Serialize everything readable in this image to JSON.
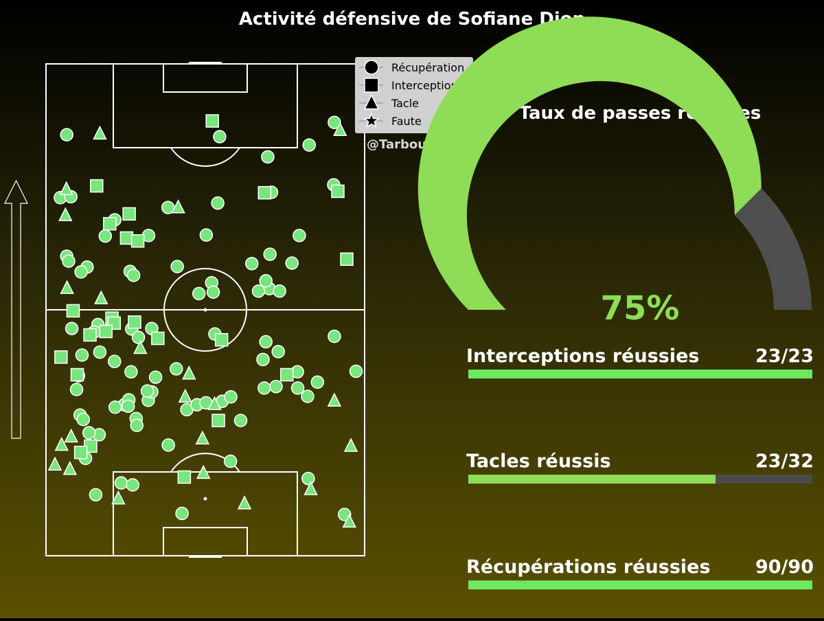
{
  "title": "Activité défensive de Sofiane Diop",
  "credit": "@TarbouchData",
  "colors": {
    "marker": "#77e67c",
    "gauge_fill": "#8fdc57",
    "gauge_rest": "#4f4f4f",
    "bar_fill": "#6ee85f",
    "bar_fill_partial": "#8fdc57",
    "bar_rest": "#4a4a4a",
    "legend_bg": "#d0d0d0"
  },
  "chart_data": [
    {
      "type": "scatter",
      "legend": {
        "placement": "top-right",
        "entries": [
          {
            "label": "Récupération",
            "shape": "circle"
          },
          {
            "label": "Interception",
            "shape": "square"
          },
          {
            "label": "Tacle",
            "shape": "triangle"
          },
          {
            "label": "Faute",
            "shape": "star"
          }
        ]
      },
      "xlim": [
        0,
        100
      ],
      "ylim": [
        0,
        100
      ],
      "series": [
        {
          "name": "Récupération",
          "shape": "circle",
          "points": [
            [
              6.5,
              85.6
            ],
            [
              54.5,
              85.2
            ],
            [
              90.5,
              88.1
            ],
            [
              82.6,
              83.5
            ],
            [
              69.6,
              81.1
            ],
            [
              4.5,
              72.8
            ],
            [
              7.8,
              73.0
            ],
            [
              70.8,
              73.9
            ],
            [
              90.3,
              75.4
            ],
            [
              53.9,
              71.7
            ],
            [
              38.3,
              70.8
            ],
            [
              21.6,
              68.3
            ],
            [
              18.6,
              65.0
            ],
            [
              32.2,
              65.1
            ],
            [
              79.5,
              65.1
            ],
            [
              50.3,
              65.2
            ],
            [
              6.5,
              60.9
            ],
            [
              7.1,
              59.9
            ],
            [
              12.9,
              58.7
            ],
            [
              11.0,
              57.7
            ],
            [
              26.4,
              57.8
            ],
            [
              27.5,
              57.0
            ],
            [
              41.2,
              58.8
            ],
            [
              64.6,
              59.4
            ],
            [
              70.3,
              61.3
            ],
            [
              77.2,
              59.5
            ],
            [
              52.0,
              55.5
            ],
            [
              52.5,
              53.6
            ],
            [
              48.0,
              53.3
            ],
            [
              70.1,
              54.3
            ],
            [
              69.0,
              55.9
            ],
            [
              66.7,
              53.8
            ],
            [
              73.3,
              53.8
            ],
            [
              16.3,
              47.0
            ],
            [
              8.1,
              46.2
            ],
            [
              15.1,
              45.5
            ],
            [
              26.9,
              46.1
            ],
            [
              33.2,
              46.2
            ],
            [
              29.0,
              44.4
            ],
            [
              53.0,
              45.1
            ],
            [
              90.5,
              44.6
            ],
            [
              69.0,
              43.5
            ],
            [
              72.9,
              41.5
            ],
            [
              11.3,
              40.8
            ],
            [
              16.9,
              41.4
            ],
            [
              21.5,
              39.5
            ],
            [
              26.7,
              37.4
            ],
            [
              34.4,
              36.3
            ],
            [
              40.9,
              38.0
            ],
            [
              68.1,
              39.9
            ],
            [
              97.3,
              37.5
            ],
            [
              78.9,
              37.4
            ],
            [
              10.2,
              36.6
            ],
            [
              9.6,
              33.8
            ],
            [
              68.5,
              34.1
            ],
            [
              72.2,
              34.4
            ],
            [
              79.0,
              34.1
            ],
            [
              85.2,
              35.3
            ],
            [
              82.1,
              32.4
            ],
            [
              24.6,
              30.7
            ],
            [
              21.7,
              30.2
            ],
            [
              26.0,
              31.7
            ],
            [
              25.8,
              30.4
            ],
            [
              32.1,
              31.6
            ],
            [
              33.2,
              33.3
            ],
            [
              31.8,
              33.5
            ],
            [
              44.2,
              29.7
            ],
            [
              47.4,
              30.7
            ],
            [
              50.2,
              31.1
            ],
            [
              55.3,
              31.4
            ],
            [
              58.0,
              32.3
            ],
            [
              61.1,
              27.5
            ],
            [
              10.7,
              28.6
            ],
            [
              11.7,
              27.7
            ],
            [
              28.3,
              27.9
            ],
            [
              28.5,
              26.5
            ],
            [
              16.7,
              24.6
            ],
            [
              13.5,
              25.0
            ],
            [
              38.4,
              22.5
            ],
            [
              11.8,
              20.5
            ],
            [
              12.4,
              19.8
            ],
            [
              57.9,
              19.2
            ],
            [
              23.6,
              14.8
            ],
            [
              27.2,
              14.4
            ],
            [
              82.3,
              15.7
            ],
            [
              15.6,
              12.4
            ],
            [
              42.7,
              8.6
            ],
            [
              93.7,
              8.4
            ]
          ]
        },
        {
          "name": "Interception",
          "shape": "square",
          "points": [
            [
              52.2,
              88.4
            ],
            [
              15.9,
              75.2
            ],
            [
              26.1,
              69.5
            ],
            [
              20.0,
              67.5
            ],
            [
              68.6,
              73.8
            ],
            [
              91.6,
              74.1
            ],
            [
              25.3,
              64.6
            ],
            [
              28.8,
              64.0
            ],
            [
              94.4,
              60.3
            ],
            [
              8.5,
              49.8
            ],
            [
              20.7,
              48.3
            ],
            [
              21.4,
              47.3
            ],
            [
              18.8,
              45.6
            ],
            [
              27.8,
              47.5
            ],
            [
              13.8,
              44.9
            ],
            [
              35.1,
              44.2
            ],
            [
              55.1,
              43.9
            ],
            [
              4.7,
              40.4
            ],
            [
              9.8,
              36.8
            ],
            [
              75.6,
              36.8
            ],
            [
              54.1,
              27.5
            ],
            [
              14.0,
              22.3
            ],
            [
              10.9,
              21.0
            ],
            [
              43.4,
              16.0
            ]
          ]
        },
        {
          "name": "Tacle",
          "shape": "triangle",
          "points": [
            [
              16.9,
              85.8
            ],
            [
              92.3,
              86.5
            ],
            [
              6.4,
              74.5
            ],
            [
              6.1,
              69.2
            ],
            [
              41.5,
              70.8
            ],
            [
              6.6,
              54.4
            ],
            [
              17.3,
              52.3
            ],
            [
              29.6,
              42.2
            ],
            [
              44.9,
              37.0
            ],
            [
              43.7,
              32.3
            ],
            [
              52.9,
              30.8
            ],
            [
              90.5,
              31.5
            ],
            [
              49.1,
              23.8
            ],
            [
              7.9,
              24.2
            ],
            [
              4.9,
              22.5
            ],
            [
              95.7,
              22.3
            ],
            [
              2.8,
              18.5
            ],
            [
              7.5,
              17.6
            ],
            [
              49.4,
              16.8
            ],
            [
              22.7,
              11.6
            ],
            [
              83.1,
              13.5
            ],
            [
              62.3,
              10.6
            ],
            [
              95.2,
              6.9
            ]
          ]
        },
        {
          "name": "Faute",
          "shape": "star",
          "points": []
        }
      ]
    },
    {
      "type": "gauge",
      "title": "Taux de passes réussies",
      "value": 75,
      "max": 100,
      "label": "75%"
    },
    {
      "type": "bar",
      "orientation": "horizontal",
      "bars": [
        {
          "label": "Interceptions réussies",
          "value_label": "23/23",
          "value": 23,
          "total": 23
        },
        {
          "label": "Tacles réussis",
          "value_label": "23/32",
          "value": 23,
          "total": 32
        },
        {
          "label": "Récupérations réussies",
          "value_label": "90/90",
          "value": 90,
          "total": 90
        }
      ]
    }
  ]
}
